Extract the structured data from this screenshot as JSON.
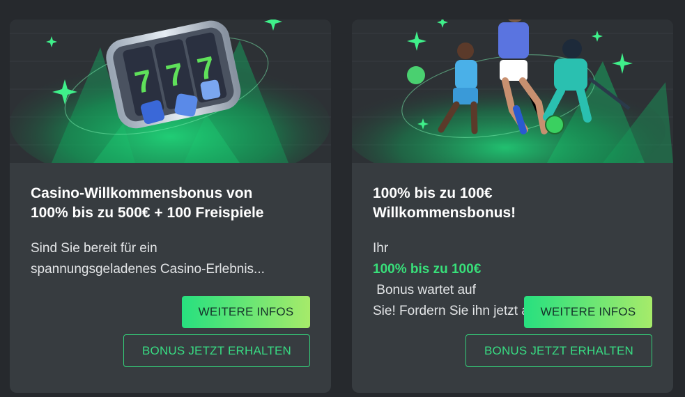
{
  "cards": [
    {
      "image": {
        "icon": "slot-machine-777-dice-illustration"
      },
      "title_lines": [
        "Casino-Willkommensbonus von",
        "100% bis zu 500€ + 100 Freispiele"
      ],
      "description_lines": [
        "Sind Sie bereit für ein",
        "spannungsgeladenes Casino-Erlebnis..."
      ],
      "more_info_label": "WEITERE INFOS",
      "get_bonus_label": "BONUS JETZT ERHALTEN"
    },
    {
      "image": {
        "icon": "sports-athletes-illustration"
      },
      "title_lines": [
        "100% bis zu 100€",
        "Willkommensbonus!"
      ],
      "description": {
        "prefix": "Ihr ",
        "highlight": "100% bis zu 100€",
        "suffix": " Bonus wartet auf",
        "line2": "Sie! Fordern Sie ihn jetzt an und starte..."
      },
      "more_info_label": "WEITERE INFOS",
      "get_bonus_label": "BONUS JETZT ERHALTEN"
    }
  ],
  "colors": {
    "page_background": "#26292d",
    "card_background": "#373c40",
    "accent_green": "#38e07a",
    "button_gradient_start": "#27e07f",
    "button_gradient_end": "#a6eb6a"
  }
}
